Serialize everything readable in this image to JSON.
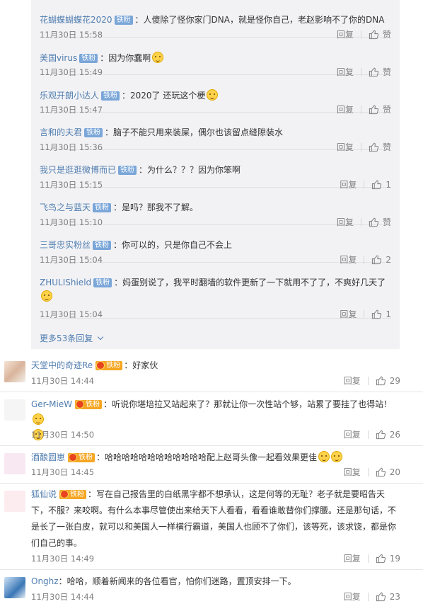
{
  "sub_replies": [
    {
      "user": "花蝴蝶蝴蝶花2020",
      "badge": "铁粉",
      "text": "：人傻除了怪你家门DNA，就是怪你自己，老赵影响不了你的DNA",
      "emoji": "",
      "time": "11月30日 15:58",
      "reply": "回复",
      "likes": "赞"
    },
    {
      "user": "美国virus",
      "badge": "铁粉",
      "text": "：因为你蠢啊",
      "emoji": "grin-emoji",
      "time": "11月30日 15:49",
      "reply": "回复",
      "likes": "赞"
    },
    {
      "user": "乐观开朗小达人",
      "badge": "铁粉",
      "text": "：2020了 还玩这个梗",
      "emoji": "thinking-emoji",
      "time": "11月30日 15:47",
      "reply": "回复",
      "likes": "赞"
    },
    {
      "user": "言和的夫君",
      "badge": "铁粉",
      "text": "：脑子不能只用来装屎，偶尔也该留点缝隙装水",
      "emoji": "",
      "time": "11月30日 15:36",
      "reply": "回复",
      "likes": "赞"
    },
    {
      "user": "我只是逛逛微博而已",
      "badge": "铁粉",
      "text": "：为什么？？？因为你笨啊",
      "emoji": "",
      "time": "11月30日 15:15",
      "reply": "回复",
      "likes": "1"
    },
    {
      "user": "飞鸟之与蓝天",
      "badge": "铁粉",
      "text": "：是吗？那我不了解。",
      "emoji": "",
      "time": "11月30日 15:10",
      "reply": "回复",
      "likes": "赞"
    },
    {
      "user": "三哥忠实粉丝",
      "badge": "铁粉",
      "text": "：你可以的，只是你自己不会上",
      "emoji": "",
      "time": "11月30日 15:04",
      "reply": "回复",
      "likes": "2"
    },
    {
      "user": "ZHULIShield",
      "badge": "铁粉",
      "text": "：妈蛋别说了，我平时翻墙的软件更新了一下就用不了了，不爽好几天了",
      "emoji": "tired-emoji",
      "time": "11月30日 15:04",
      "reply": "回复",
      "likes": "1"
    }
  ],
  "more_replies": "更多53条回复",
  "comments": [
    {
      "user": "天堂中的奇迹Re",
      "badge": "铁粉",
      "text": "：好家伙",
      "emoji": "",
      "time": "11月30日 14:44",
      "reply": "回复",
      "likes": "29"
    },
    {
      "user": "Ger-MieW",
      "badge": "铁粉",
      "text": "：听说你堪培拉又站起来了？那就让你一次性站个够，站累了要挂了也得站！",
      "emoji": "smile-emoji",
      "time": "11月30日 14:50",
      "reply": "回复",
      "likes": "26"
    },
    {
      "user": "酒酿圆崽",
      "badge": "铁粉",
      "text": "：哈哈哈哈哈哈哈哈哈哈哈哈配上赵哥头像一起看效果更佳",
      "emoji": "thumbs-emoji",
      "time": "11月30日 14:45",
      "reply": "回复",
      "likes": "20"
    },
    {
      "user": "狐仙说",
      "badge": "铁粉",
      "text": "：写在自己报告里的白纸黑字都不想承认，这是何等的无耻？老子就是要昭告天下，不服？来咬啊。有什么本事尽管使出来给天下人看看，看看谁敢替你们撑腰。还是那句话，不是长了一张白皮，就可以和美国人一样横行霸道，美国人也顾不了你们，该等死，该求饶，都是你们自己的事。",
      "emoji": "",
      "time": "11月30日 14:49",
      "reply": "回复",
      "likes": "19"
    },
    {
      "user": "Onghz",
      "badge": "",
      "text": "：哈哈，顺着新闻来的各位看官，怕你们迷路，置顶安排一下。",
      "emoji": "",
      "time": "11月30日 14:44",
      "reply": "回复",
      "likes": "23"
    }
  ],
  "colors": {
    "username": "#507daf",
    "badge_blue": "#7aa6d8",
    "badge_gold": "#f5a623",
    "meta_gray": "#808080"
  }
}
